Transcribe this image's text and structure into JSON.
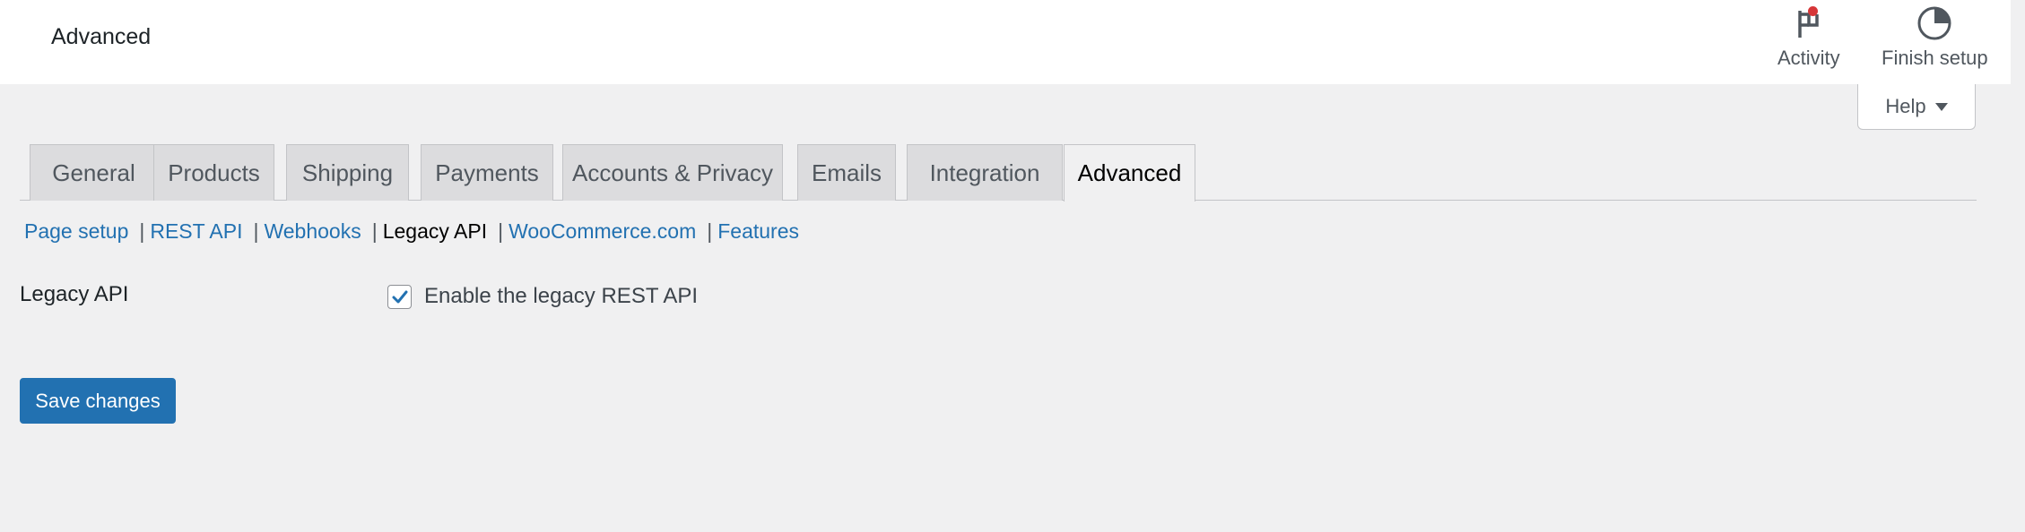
{
  "header": {
    "title": "Advanced",
    "activity_label": "Activity",
    "finish_setup_label": "Finish setup"
  },
  "help": {
    "label": "Help"
  },
  "tabs": [
    {
      "label": "General"
    },
    {
      "label": "Products"
    },
    {
      "label": "Shipping"
    },
    {
      "label": "Payments"
    },
    {
      "label": "Accounts & Privacy"
    },
    {
      "label": "Emails"
    },
    {
      "label": "Integration"
    },
    {
      "label": "Advanced",
      "active": true
    }
  ],
  "subnav": [
    {
      "label": "Page setup"
    },
    {
      "label": "REST API"
    },
    {
      "label": "Webhooks"
    },
    {
      "label": "Legacy API",
      "current": true
    },
    {
      "label": "WooCommerce.com"
    },
    {
      "label": "Features"
    }
  ],
  "settings": {
    "legacy_api": {
      "label": "Legacy API",
      "checkbox_label": "Enable the legacy REST API",
      "checked": true
    }
  },
  "actions": {
    "save_label": "Save changes"
  },
  "colors": {
    "accent": "#2271b1",
    "notification": "#d63638",
    "background": "#f0f0f1"
  }
}
